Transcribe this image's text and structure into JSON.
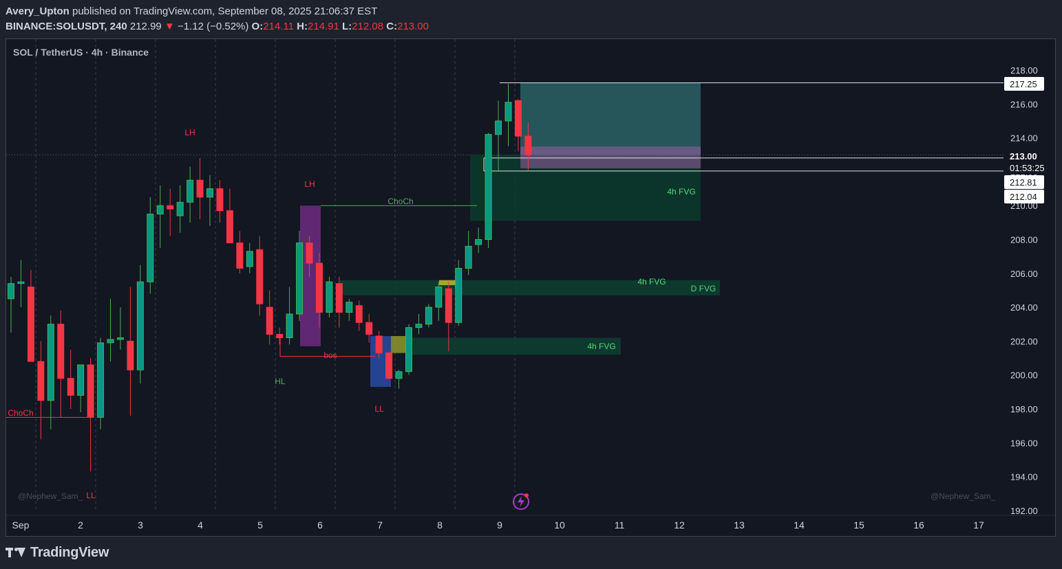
{
  "header": {
    "author": "Avery_Upton",
    "published": " published on TradingView.com, September 08, 2025 21:06:37 EST",
    "symbol": "BINANCE:SOLUSDT, 240",
    "last": "212.99",
    "change": "−1.12 (−0.52%)",
    "o_label": "O:",
    "o_value": "214.11",
    "h_label": "H:",
    "h_value": "214.91",
    "l_label": "L:",
    "l_value": "212.08",
    "c_label": "C:",
    "c_value": "213.00"
  },
  "footer": {
    "brand": "TradingView"
  },
  "chart_data": {
    "type": "candlestick",
    "title": "SOL / TetherUS · 4h · Binance",
    "watermark": "@Nephew_Sam_",
    "y_axis": {
      "ticks": [
        192,
        194,
        196,
        198,
        200,
        202,
        204,
        206,
        208,
        210,
        212,
        214,
        216,
        218
      ],
      "range": [
        192,
        220
      ]
    },
    "x_axis": {
      "labels": [
        "Sep",
        "2",
        "3",
        "4",
        "5",
        "6",
        "7",
        "8",
        "9",
        "10",
        "11",
        "12",
        "13",
        "14",
        "15",
        "16",
        "17"
      ]
    },
    "price_labels": [
      {
        "text": "217.25",
        "value": 217.25
      },
      {
        "text": "213.00",
        "value": 213.0,
        "current": true
      },
      {
        "text": "01:53:25",
        "value": 212.35,
        "countdown": true
      },
      {
        "text": "212.81",
        "value": 212.81
      },
      {
        "text": "212.04",
        "value": 212.04
      }
    ],
    "candles": [
      {
        "o": 204.5,
        "h": 205.8,
        "l": 202.5,
        "c": 205.4
      },
      {
        "o": 205.4,
        "h": 206.8,
        "l": 204.0,
        "c": 205.5
      },
      {
        "o": 205.2,
        "h": 206.2,
        "l": 201.5,
        "c": 200.8
      },
      {
        "o": 200.8,
        "h": 202.0,
        "l": 196.2,
        "c": 198.5
      },
      {
        "o": 198.5,
        "h": 203.5,
        "l": 196.8,
        "c": 203.0
      },
      {
        "o": 203.0,
        "h": 203.8,
        "l": 197.5,
        "c": 199.8
      },
      {
        "o": 199.8,
        "h": 201.5,
        "l": 198.0,
        "c": 198.8
      },
      {
        "o": 198.8,
        "h": 200.6,
        "l": 197.8,
        "c": 200.6
      },
      {
        "o": 200.6,
        "h": 201.0,
        "l": 194.3,
        "c": 197.5
      },
      {
        "o": 197.5,
        "h": 202.2,
        "l": 196.8,
        "c": 201.9
      },
      {
        "o": 201.9,
        "h": 204.5,
        "l": 200.8,
        "c": 202.1
      },
      {
        "o": 202.1,
        "h": 204.0,
        "l": 201.5,
        "c": 202.2
      },
      {
        "o": 202.0,
        "h": 205.2,
        "l": 197.6,
        "c": 200.3
      },
      {
        "o": 200.3,
        "h": 206.5,
        "l": 199.5,
        "c": 205.5
      },
      {
        "o": 205.5,
        "h": 210.5,
        "l": 204.8,
        "c": 209.5
      },
      {
        "o": 209.5,
        "h": 211.2,
        "l": 207.5,
        "c": 210.0
      },
      {
        "o": 210.0,
        "h": 211.0,
        "l": 208.2,
        "c": 209.8
      },
      {
        "o": 209.4,
        "h": 211.2,
        "l": 208.4,
        "c": 210.2
      },
      {
        "o": 210.2,
        "h": 212.3,
        "l": 209.0,
        "c": 211.5
      },
      {
        "o": 211.5,
        "h": 212.8,
        "l": 209.2,
        "c": 210.5
      },
      {
        "o": 210.5,
        "h": 211.8,
        "l": 208.8,
        "c": 211.0
      },
      {
        "o": 211.0,
        "h": 211.5,
        "l": 209.0,
        "c": 209.7
      },
      {
        "o": 209.7,
        "h": 211.0,
        "l": 207.8,
        "c": 207.8
      },
      {
        "o": 207.8,
        "h": 208.5,
        "l": 206.0,
        "c": 206.3
      },
      {
        "o": 206.4,
        "h": 207.8,
        "l": 206.0,
        "c": 207.3
      },
      {
        "o": 207.4,
        "h": 208.2,
        "l": 203.5,
        "c": 204.2
      },
      {
        "o": 204.0,
        "h": 205.0,
        "l": 201.8,
        "c": 202.4
      },
      {
        "o": 202.4,
        "h": 202.8,
        "l": 201.8,
        "c": 202.2
      },
      {
        "o": 202.2,
        "h": 205.2,
        "l": 201.8,
        "c": 203.6
      },
      {
        "o": 203.6,
        "h": 208.5,
        "l": 203.2,
        "c": 207.8
      },
      {
        "o": 207.8,
        "h": 208.2,
        "l": 205.8,
        "c": 206.6
      },
      {
        "o": 206.6,
        "h": 207.2,
        "l": 202.8,
        "c": 203.7
      },
      {
        "o": 203.7,
        "h": 205.8,
        "l": 203.4,
        "c": 205.5
      },
      {
        "o": 205.4,
        "h": 205.8,
        "l": 202.8,
        "c": 203.7
      },
      {
        "o": 203.7,
        "h": 204.5,
        "l": 203.2,
        "c": 204.3
      },
      {
        "o": 204.1,
        "h": 204.4,
        "l": 202.6,
        "c": 203.1
      },
      {
        "o": 203.1,
        "h": 203.6,
        "l": 201.9,
        "c": 202.4
      },
      {
        "o": 202.3,
        "h": 202.6,
        "l": 201.0,
        "c": 201.3
      },
      {
        "o": 201.3,
        "h": 201.4,
        "l": 199.8,
        "c": 199.8
      },
      {
        "o": 199.8,
        "h": 200.3,
        "l": 199.2,
        "c": 200.2
      },
      {
        "o": 200.2,
        "h": 203.0,
        "l": 200.0,
        "c": 202.8
      },
      {
        "o": 202.8,
        "h": 203.6,
        "l": 202.4,
        "c": 203.0
      },
      {
        "o": 203.0,
        "h": 204.2,
        "l": 202.8,
        "c": 204.0
      },
      {
        "o": 204.0,
        "h": 205.5,
        "l": 203.2,
        "c": 205.2
      },
      {
        "o": 205.1,
        "h": 205.5,
        "l": 201.4,
        "c": 203.1
      },
      {
        "o": 203.1,
        "h": 206.8,
        "l": 202.9,
        "c": 206.3
      },
      {
        "o": 206.3,
        "h": 208.5,
        "l": 205.9,
        "c": 207.6
      },
      {
        "o": 207.7,
        "h": 208.7,
        "l": 207.2,
        "c": 208.0
      },
      {
        "o": 208.0,
        "h": 214.3,
        "l": 207.5,
        "c": 214.2
      },
      {
        "o": 214.2,
        "h": 216.2,
        "l": 212.0,
        "c": 215.0
      },
      {
        "o": 215.0,
        "h": 217.2,
        "l": 213.5,
        "c": 216.1
      },
      {
        "o": 216.2,
        "h": 216.3,
        "l": 213.2,
        "c": 214.1
      },
      {
        "o": 214.1,
        "h": 214.9,
        "l": 212.08,
        "c": 213.0
      }
    ],
    "zones": [
      {
        "label": "4h FVG",
        "y_bottom": 209.1,
        "y_top": 213.0,
        "fill": "#0b3a2b"
      },
      {
        "label": "4h FVG",
        "y_bottom": 204.7,
        "y_top": 205.6,
        "fill": "#0d3f30"
      },
      {
        "label": "D FVG",
        "y_bottom": 204.7,
        "y_top": 205.5,
        "fill": "#0d3f30"
      },
      {
        "label": "4h FVG",
        "y_bottom": 201.2,
        "y_top": 202.2,
        "fill": "#0d3f30"
      }
    ],
    "position": {
      "target_top": 217.25,
      "entry": 213.0,
      "stop": 212.04,
      "target_fill": "#2d6b6e",
      "stop_fill": "#9c5fa6"
    },
    "annotations": [
      {
        "text": "LH",
        "color": "#f23645"
      },
      {
        "text": "LH",
        "color": "#f23645"
      },
      {
        "text": "ChoCh",
        "color": "#4caf50"
      },
      {
        "text": "ChoCh",
        "color": "#f23645"
      },
      {
        "text": "bos",
        "color": "#f23645"
      },
      {
        "text": "HL",
        "color": "#4caf50"
      },
      {
        "text": "LL",
        "color": "#f23645"
      },
      {
        "text": "LL",
        "color": "#f23645"
      }
    ],
    "colors": {
      "up": "#089981",
      "up_border": "#4caf50",
      "down": "#f23645",
      "bg": "#131722",
      "grid": "#2a2e39",
      "axis_text": "#d1d4dc"
    }
  }
}
